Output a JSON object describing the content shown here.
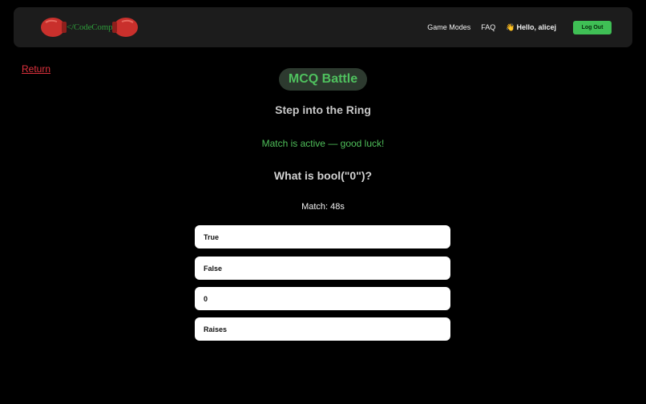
{
  "nav": {
    "brand": "</CodeComp",
    "links": [
      "Game Modes",
      "FAQ"
    ],
    "wave_icon": "👋",
    "greeting": "Hello, alicej",
    "logout": "Log Out"
  },
  "return_link": "Return",
  "battle": {
    "title": "MCQ Battle",
    "subtitle": "Step into the Ring",
    "status": "Match is active — good luck!",
    "question": "What is bool(\"0\")?",
    "timer": "Match: 48s",
    "options": [
      "True",
      "False",
      "0",
      "Raises"
    ]
  },
  "colors": {
    "accent_green": "#4fc15e",
    "button_green": "#3fbf55",
    "return_red": "#e0323e",
    "glove_red": "#c9302c",
    "navbar_bg": "#1c1c1c"
  },
  "icons": {
    "logo_left": "boxing-glove-icon",
    "logo_right": "boxing-glove-icon"
  }
}
